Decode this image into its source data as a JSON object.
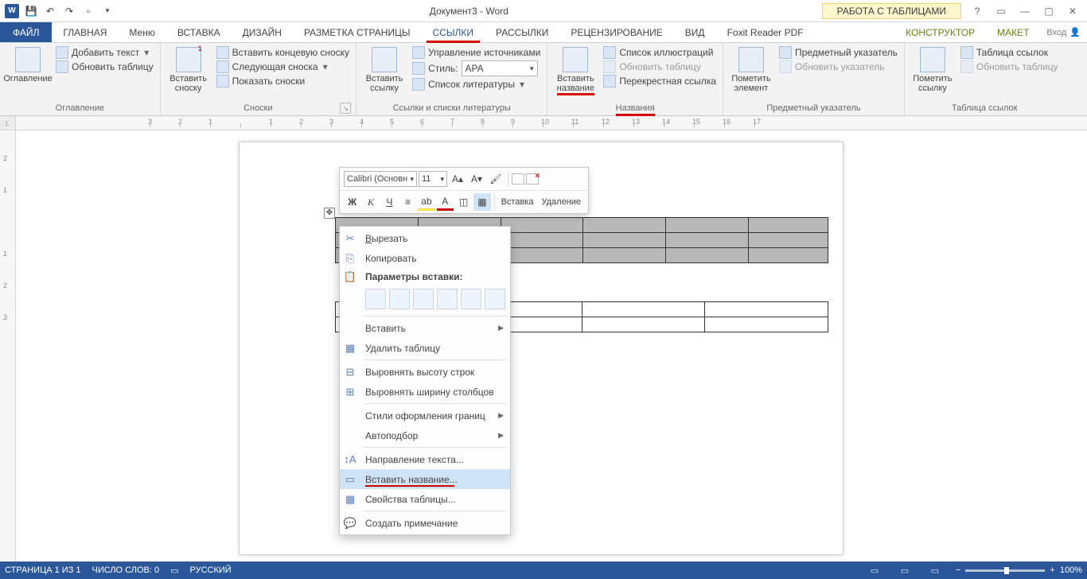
{
  "title": "Документ3 - Word",
  "tools_tab": "РАБОТА С ТАБЛИЦАМИ",
  "login": "Вход",
  "tabs": {
    "file": "ФАЙЛ",
    "home": "ГЛАВНАЯ",
    "menu": "Меню",
    "insert": "ВСТАВКА",
    "design": "ДИЗАЙН",
    "layout": "РАЗМЕТКА СТРАНИЦЫ",
    "references": "ССЫЛКИ",
    "mailings": "РАССЫЛКИ",
    "review": "РЕЦЕНЗИРОВАНИЕ",
    "view": "ВИД",
    "foxit": "Foxit Reader PDF",
    "tdesign": "КОНСТРУКТОР",
    "tlayout": "МАКЕТ"
  },
  "ribbon": {
    "toc": {
      "big": "Оглавление",
      "add_text": "Добавить текст",
      "update": "Обновить таблицу",
      "group": "Оглавление"
    },
    "footnotes": {
      "big": "Вставить\nсноску",
      "end": "Вставить концевую сноску",
      "next": "Следующая сноска",
      "show": "Показать сноски",
      "group": "Сноски"
    },
    "cit": {
      "big": "Вставить\nссылку",
      "manage": "Управление источниками",
      "style_lbl": "Стиль:",
      "style_val": "APA",
      "biblio": "Список литературы",
      "group": "Ссылки и списки литературы"
    },
    "caption": {
      "big": "Вставить\nназвание",
      "illus": "Список иллюстраций",
      "update": "Обновить таблицу",
      "xref": "Перекрестная ссылка",
      "group": "Названия"
    },
    "index": {
      "big": "Пометить\nэлемент",
      "idx": "Предметный указатель",
      "update": "Обновить указатель",
      "group": "Предметный указатель"
    },
    "toa": {
      "big": "Пометить\nссылку",
      "list": "Таблица ссылок",
      "update": "Обновить таблицу",
      "group": "Таблица ссылок"
    }
  },
  "minitb": {
    "font": "Calibri (Основн",
    "size": "11",
    "insert": "Вставка",
    "delete": "Удаление"
  },
  "context": {
    "cut": "Вырезать",
    "copy": "Копировать",
    "paste_header": "Параметры вставки:",
    "insert": "Вставить",
    "del_table": "Удалить таблицу",
    "row_h": "Выровнять высоту строк",
    "col_w": "Выровнять ширину столбцов",
    "border_styles": "Стили оформления границ",
    "autofit": "Автоподбор",
    "text_dir": "Направление текста...",
    "ins_caption": "Вставить название...",
    "tbl_props": "Свойства таблицы...",
    "comment": "Создать примечание"
  },
  "status": {
    "page": "СТРАНИЦА 1 ИЗ 1",
    "words": "ЧИСЛО СЛОВ: 0",
    "lang": "РУССКИЙ",
    "zoom": "100%"
  },
  "ruler_marks": [
    "3",
    "2",
    "1",
    "",
    "1",
    "2",
    "3",
    "4",
    "5",
    "6",
    "7",
    "8",
    "9",
    "10",
    "11",
    "12",
    "13",
    "14",
    "15",
    "16",
    "17"
  ]
}
